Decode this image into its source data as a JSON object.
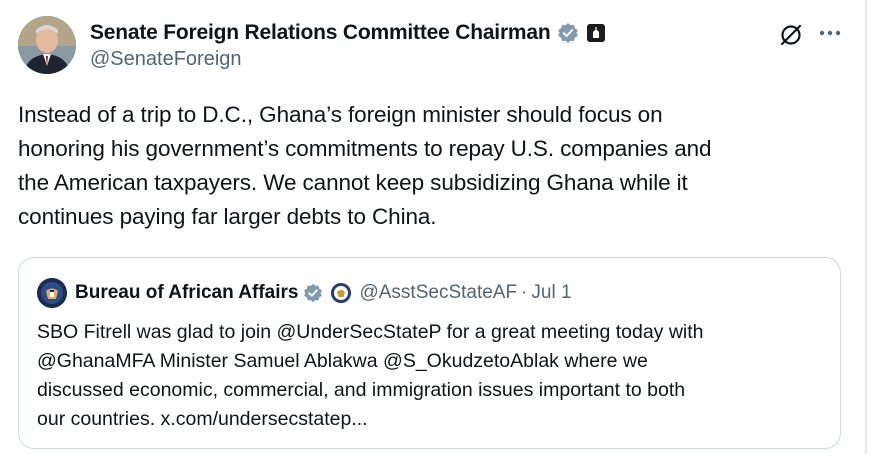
{
  "author": {
    "display_name": "Senate Foreign Relations Committee Chairman",
    "handle": "@SenateForeign"
  },
  "tweet": {
    "text": "Instead of a trip to D.C., Ghana’s foreign minister should focus on\nhonoring his government’s commitments to repay U.S. companies and\nthe American taxpayers. We cannot keep subsidizing Ghana while it\ncontinues paying far larger debts to China."
  },
  "quoted": {
    "display_name": "Bureau of African Affairs",
    "handle": "@AsstSecStateAF",
    "separator": "·",
    "date": "Jul 1",
    "text": "SBO Fitrell was glad to join @UnderSecStateP for a great meeting today with\n@GhanaMFA Minister Samuel Ablakwa @S_OkudzetoAblak where we\ndiscussed economic, commercial, and immigration issues important to both\nour countries. x.com/undersecstatep..."
  },
  "icons": {
    "verified": "verified-badge-icon",
    "government": "government-badge-icon",
    "grok": "grok-icon",
    "more": "more-icon"
  },
  "colors": {
    "verified_gray": "#829aab",
    "text": "#0f1419",
    "secondary": "#536471",
    "border": "#cfd9de"
  }
}
